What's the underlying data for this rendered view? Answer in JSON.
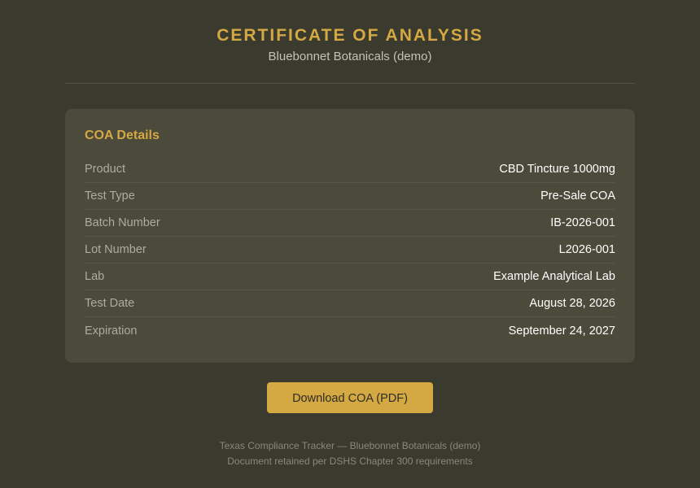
{
  "header": {
    "title": "CERTIFICATE OF ANALYSIS",
    "subtitle": "Bluebonnet Botanicals (demo)"
  },
  "details": {
    "heading": "COA Details",
    "rows": [
      {
        "label": "Product",
        "value": "CBD Tincture 1000mg"
      },
      {
        "label": "Test Type",
        "value": "Pre-Sale COA"
      },
      {
        "label": "Batch Number",
        "value": "IB-2026-001"
      },
      {
        "label": "Lot Number",
        "value": "L2026-001"
      },
      {
        "label": "Lab",
        "value": "Example Analytical Lab"
      },
      {
        "label": "Test Date",
        "value": "August 28, 2026"
      },
      {
        "label": "Expiration",
        "value": "September 24, 2027"
      }
    ]
  },
  "actions": {
    "download_label": "Download COA (PDF)"
  },
  "footer": {
    "line1": "Texas Compliance Tracker — Bluebonnet Botanicals (demo)",
    "line2": "Document retained per DSHS Chapter 300 requirements"
  },
  "colors": {
    "background": "#3a3a2e",
    "card": "#4b4a3b",
    "accent": "#d4a843"
  }
}
